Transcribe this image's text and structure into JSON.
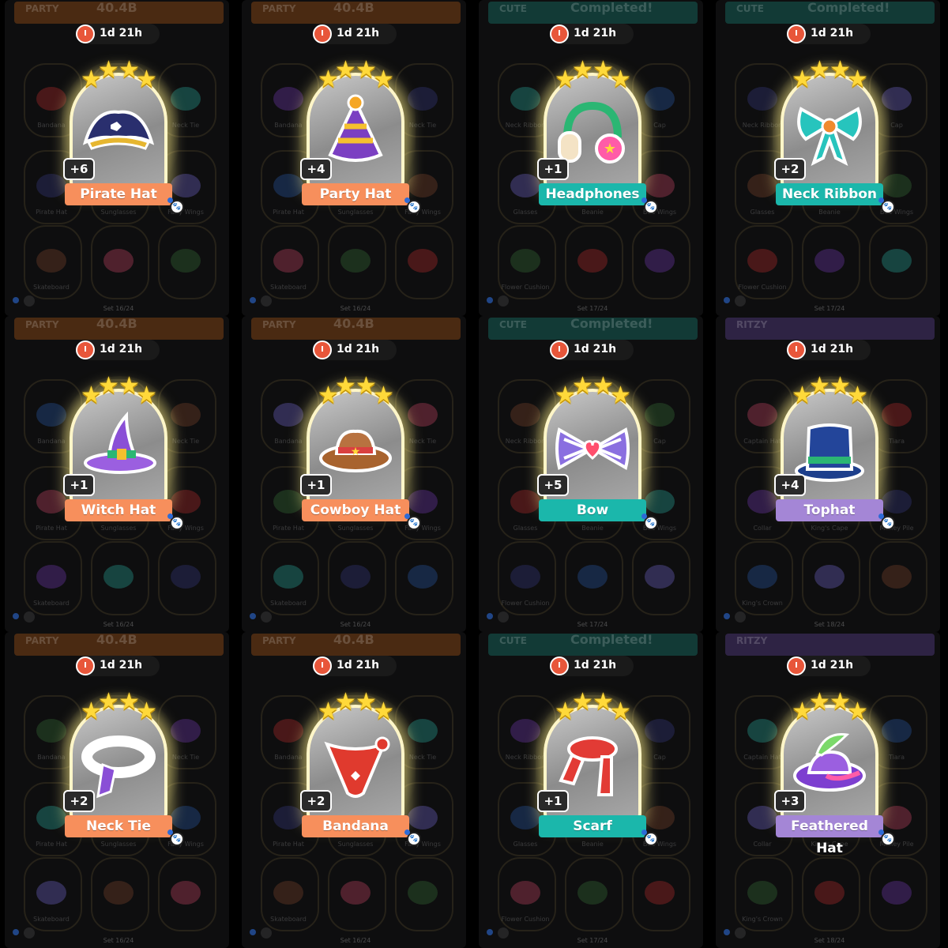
{
  "colors": {
    "orange": "#f78f5c",
    "teal": "#1bb7ab",
    "purple": "#a486d6",
    "star": "#ffd93a"
  },
  "cards": [
    {
      "id": "pirate-hat",
      "name": "Pirate Hat",
      "count": "+6",
      "timer": "1d 21h",
      "color": "orange",
      "icon": "pirate-hat-icon",
      "banner_label": "PARTY",
      "banner_value": "40.4B",
      "set": "Set 16/24",
      "album": "party"
    },
    {
      "id": "party-hat",
      "name": "Party Hat",
      "count": "+4",
      "timer": "1d 21h",
      "color": "orange",
      "icon": "party-hat-icon",
      "banner_label": "PARTY",
      "banner_value": "40.4B",
      "set": "Set 16/24",
      "album": "party"
    },
    {
      "id": "headphones",
      "name": "Headphones",
      "count": "+1",
      "timer": "1d 21h",
      "color": "teal",
      "icon": "headphones-icon",
      "banner_label": "CUTE",
      "banner_value": "Completed!",
      "set": "Set 17/24",
      "album": "cute"
    },
    {
      "id": "neck-ribbon",
      "name": "Neck Ribbon",
      "count": "+2",
      "timer": "1d 21h",
      "color": "teal",
      "icon": "neck-ribbon-icon",
      "banner_label": "CUTE",
      "banner_value": "Completed!",
      "set": "Set 17/24",
      "album": "cute"
    },
    {
      "id": "witch-hat",
      "name": "Witch Hat",
      "count": "+1",
      "timer": "1d 21h",
      "color": "orange",
      "icon": "witch-hat-icon",
      "banner_label": "PARTY",
      "banner_value": "40.4B",
      "set": "Set 16/24",
      "album": "party"
    },
    {
      "id": "cowboy-hat",
      "name": "Cowboy Hat",
      "count": "+1",
      "timer": "1d 21h",
      "color": "orange",
      "icon": "cowboy-hat-icon",
      "banner_label": "PARTY",
      "banner_value": "40.4B",
      "set": "Set 16/24",
      "album": "party"
    },
    {
      "id": "bow",
      "name": "Bow",
      "count": "+5",
      "timer": "1d 21h",
      "color": "teal",
      "icon": "bow-icon",
      "banner_label": "CUTE",
      "banner_value": "Completed!",
      "set": "Set 17/24",
      "album": "cute"
    },
    {
      "id": "tophat",
      "name": "Tophat",
      "count": "+4",
      "timer": "1d 21h",
      "color": "purple",
      "icon": "tophat-icon",
      "banner_label": "RITZY",
      "banner_value": "",
      "set": "Set 18/24",
      "album": "ritzy"
    },
    {
      "id": "neck-tie",
      "name": "Neck Tie",
      "count": "+2",
      "timer": "1d 21h",
      "color": "orange",
      "icon": "neck-tie-icon",
      "banner_label": "PARTY",
      "banner_value": "40.4B",
      "set": "Set 16/24",
      "album": "party"
    },
    {
      "id": "bandana",
      "name": "Bandana",
      "count": "+2",
      "timer": "1d 21h",
      "color": "orange",
      "icon": "bandana-icon",
      "banner_label": "PARTY",
      "banner_value": "40.4B",
      "set": "Set 16/24",
      "album": "party"
    },
    {
      "id": "scarf",
      "name": "Scarf",
      "count": "+1",
      "timer": "1d 21h",
      "color": "teal",
      "icon": "scarf-icon",
      "banner_label": "CUTE",
      "banner_value": "Completed!",
      "set": "Set 17/24",
      "album": "cute"
    },
    {
      "id": "feathered-hat",
      "name": "Feathered Hat",
      "count": "+3",
      "timer": "1d 21h",
      "color": "purple",
      "icon": "feathered-hat-icon",
      "banner_label": "RITZY",
      "banner_value": "",
      "set": "Set 18/24",
      "album": "ritzy"
    }
  ],
  "albums": {
    "party": {
      "banner_color": "#4a2a12",
      "items": [
        "Bandana",
        "Party Hat",
        "Neck Tie",
        "Pirate Hat",
        "Sunglasses",
        "Fairy Wings",
        "Skateboard"
      ]
    },
    "cute": {
      "banner_color": "#123a36",
      "items": [
        "Neck Ribbon",
        "Bow",
        "Cap",
        "Glasses",
        "Beanie",
        "Bee Wings",
        "Flower Cushion"
      ]
    },
    "ritzy": {
      "banner_color": "#2e2344",
      "items": [
        "Captain Hat",
        "Tophat",
        "Tiara",
        "Collar",
        "King's Cape",
        "Money Pile",
        "King's Crown"
      ]
    }
  }
}
